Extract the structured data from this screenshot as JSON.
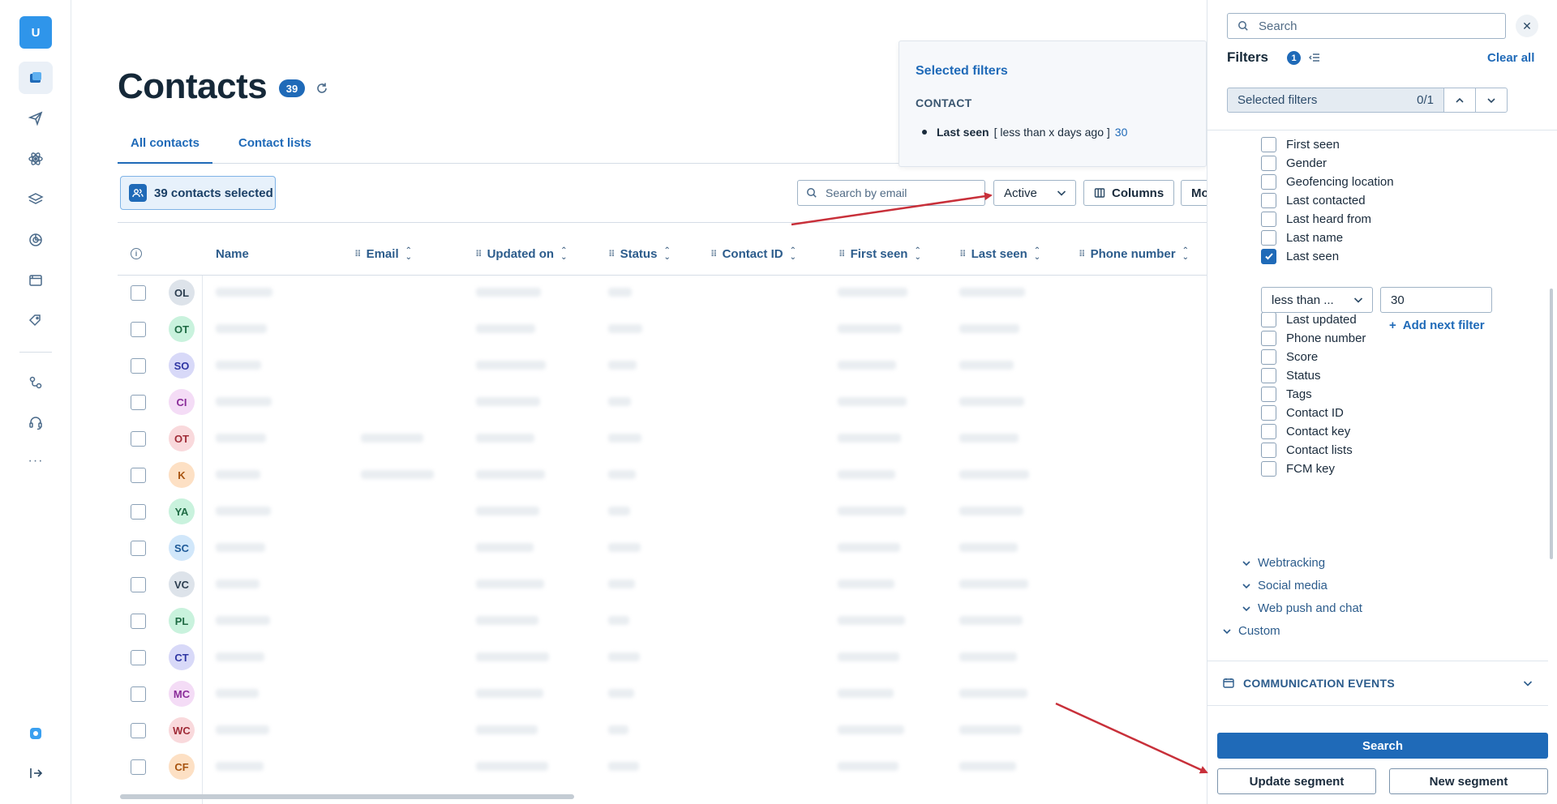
{
  "rail": {
    "user_initial": "U",
    "more": "···"
  },
  "header": {
    "title": "Contacts",
    "count": "39"
  },
  "tabs": [
    {
      "label": "All contacts"
    },
    {
      "label": "Contact lists"
    }
  ],
  "toolbar": {
    "selected_label": "39 contacts selected",
    "search_placeholder": "Search by email",
    "status_filter": "Active",
    "columns_label": "Columns",
    "more_label": "Mo"
  },
  "table": {
    "columns": [
      "Name",
      "Email",
      "Updated on",
      "Status",
      "Contact ID",
      "First seen",
      "Last seen",
      "Phone number"
    ],
    "rows": [
      {
        "initials": "OL",
        "bg": "#dde3ea",
        "fg": "#2c3e50"
      },
      {
        "initials": "OT",
        "bg": "#c9f2dd",
        "fg": "#1f6b44"
      },
      {
        "initials": "SO",
        "bg": "#d8d9f8",
        "fg": "#2f36a3"
      },
      {
        "initials": "CI",
        "bg": "#f4dcf6",
        "fg": "#8a2c99"
      },
      {
        "initials": "OT",
        "bg": "#f9d9dc",
        "fg": "#a02c38"
      },
      {
        "initials": "K",
        "bg": "#fde0c4",
        "fg": "#a8530f"
      },
      {
        "initials": "YA",
        "bg": "#c9f2dd",
        "fg": "#1f6b44"
      },
      {
        "initials": "SC",
        "bg": "#d1e7fa",
        "fg": "#1f5b99"
      },
      {
        "initials": "VC",
        "bg": "#dde3ea",
        "fg": "#2c3e50"
      },
      {
        "initials": "PL",
        "bg": "#c9f2dd",
        "fg": "#1f6b44"
      },
      {
        "initials": "CT",
        "bg": "#d8d9f8",
        "fg": "#2f36a3"
      },
      {
        "initials": "MC",
        "bg": "#f4dcf6",
        "fg": "#8a2c99"
      },
      {
        "initials": "WC",
        "bg": "#f9d9dc",
        "fg": "#a02c38"
      },
      {
        "initials": "CF",
        "bg": "#fde0c4",
        "fg": "#a8530f"
      }
    ]
  },
  "popover": {
    "title": "Selected filters",
    "section": "CONTACT",
    "item_field": "Last seen",
    "item_condition": "[ less than x days ago ]",
    "item_value": "30"
  },
  "panel": {
    "search_placeholder": "Search",
    "filters_label": "Filters",
    "filters_count": "1",
    "clear_all": "Clear all",
    "selected_filters_label": "Selected filters",
    "selected_filters_nav": "0/1",
    "fields": [
      {
        "label": "First seen",
        "checked": false
      },
      {
        "label": "Gender",
        "checked": false
      },
      {
        "label": "Geofencing location",
        "checked": false
      },
      {
        "label": "Last contacted",
        "checked": false
      },
      {
        "label": "Last heard from",
        "checked": false
      },
      {
        "label": "Last name",
        "checked": false
      },
      {
        "label": "Last seen",
        "checked": true
      },
      {
        "label": "Last updated",
        "checked": false
      },
      {
        "label": "Phone number",
        "checked": false
      },
      {
        "label": "Score",
        "checked": false
      },
      {
        "label": "Status",
        "checked": false
      },
      {
        "label": "Tags",
        "checked": false
      },
      {
        "label": "Contact ID",
        "checked": false
      },
      {
        "label": "Contact key",
        "checked": false
      },
      {
        "label": "Contact lists",
        "checked": false
      },
      {
        "label": "FCM key",
        "checked": false
      }
    ],
    "operator": "less than ...",
    "value": "30",
    "add_next_filter": "Add next filter",
    "groups": [
      "Webtracking",
      "Social media",
      "Web push and chat"
    ],
    "custom": "Custom",
    "communication_events": "COMMUNICATION EVENTS",
    "search_button": "Search",
    "update_segment": "Update segment",
    "new_segment": "New segment"
  },
  "colors": {
    "accent": "#1f6ab8",
    "annotation_arrow": "#c8303a"
  }
}
